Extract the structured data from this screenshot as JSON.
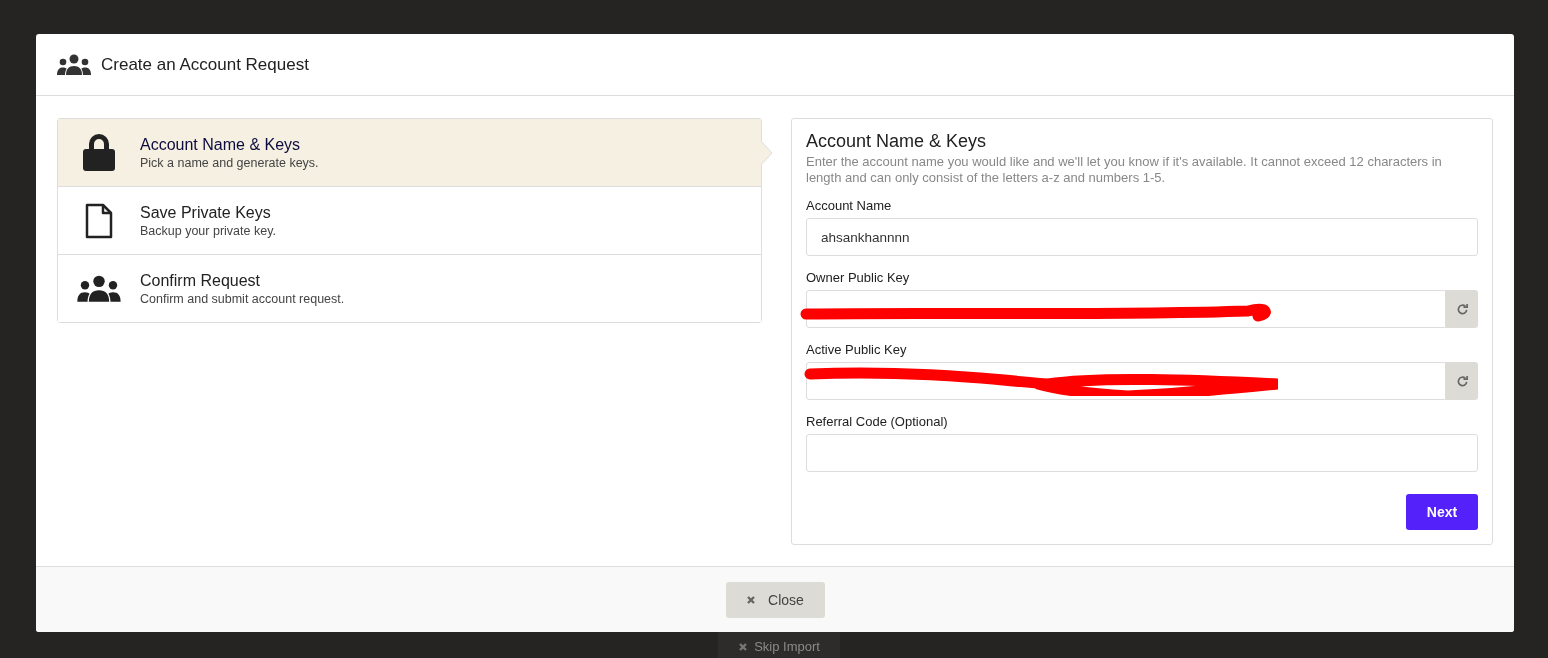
{
  "backdrop": {
    "button": "Skip Import"
  },
  "dialog": {
    "title": "Create an Account Request",
    "steps": [
      {
        "kind": "lock",
        "title": "Account Name & Keys",
        "subtitle": "Pick a name and generate keys.",
        "selected": true
      },
      {
        "kind": "file",
        "title": "Save Private Keys",
        "subtitle": "Backup your private key.",
        "selected": false
      },
      {
        "kind": "users",
        "title": "Confirm Request",
        "subtitle": "Confirm and submit account request.",
        "selected": false
      }
    ],
    "form": {
      "heading": "Account Name & Keys",
      "description": "Enter the account name you would like and we'll let you know if it's available. It cannot exceed 12 characters in length and can only consist of the letters a-z and numbers 1-5.",
      "fields": [
        {
          "kind": "text",
          "label": "Account Name",
          "value": "ahsankhannnn"
        },
        {
          "kind": "key",
          "label": "Owner Public Key",
          "redacted": true
        },
        {
          "kind": "key",
          "label": "Active Public Key",
          "redacted": true
        },
        {
          "kind": "text",
          "label": "Referral Code (Optional)"
        }
      ],
      "submit": "Next"
    },
    "close": "Close"
  }
}
